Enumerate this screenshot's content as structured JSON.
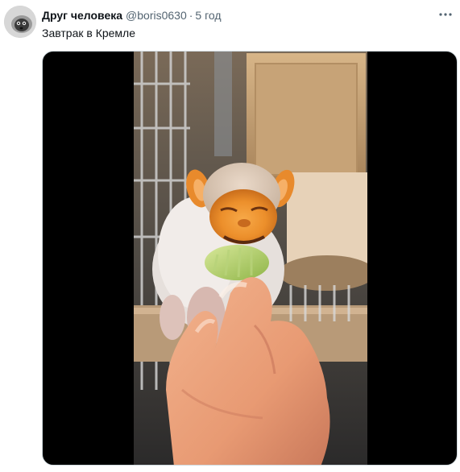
{
  "tweet": {
    "author": {
      "display_name": "Друг человека",
      "handle": "@boris0630",
      "avatar_icon": "lemur-face-avatar-icon"
    },
    "separator": "·",
    "timestamp": "5 год",
    "text": "Завтрак в Кремле",
    "more_icon": "more-horizontal-icon"
  },
  "media": {
    "kind": "video-frame",
    "icon": "hairless-monkey-photo"
  },
  "colors": {
    "text_primary": "#0f1419",
    "text_secondary": "#536471",
    "media_background": "#000000"
  }
}
